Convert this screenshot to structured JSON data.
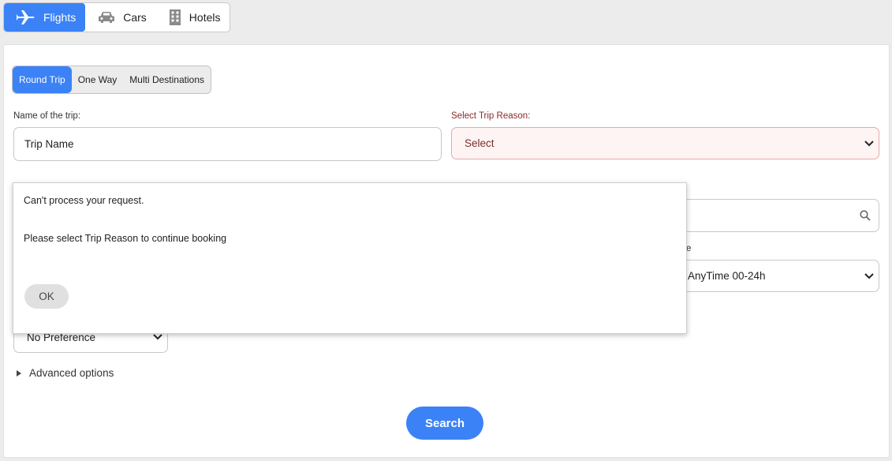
{
  "tabs": [
    {
      "label": "Flights",
      "icon": "plane-icon",
      "active": true
    },
    {
      "label": "Cars",
      "icon": "car-icon",
      "active": false
    },
    {
      "label": "Hotels",
      "icon": "building-icon",
      "active": false
    }
  ],
  "trip_types": [
    {
      "label": "Round Trip",
      "active": true
    },
    {
      "label": "One Way",
      "active": false
    },
    {
      "label": "Multi Destinations",
      "active": false
    }
  ],
  "form": {
    "trip_name_label": "Name of the trip:",
    "trip_name_value": "Trip Name",
    "trip_reason_label": "Select Trip Reason:",
    "trip_reason_value": "Select",
    "time_partial_label": "e",
    "time_value": "AnyTime 00-24h",
    "preference_value": "No Preference",
    "advanced_label": "Advanced options",
    "search_label": "Search"
  },
  "modal": {
    "line1": "Can't process your request.",
    "line2": "Please select Trip Reason to continue booking",
    "ok_label": "OK"
  },
  "colors": {
    "accent": "#3b82f6",
    "error_text": "#8a2b2b",
    "error_bg": "#fff4f4"
  }
}
